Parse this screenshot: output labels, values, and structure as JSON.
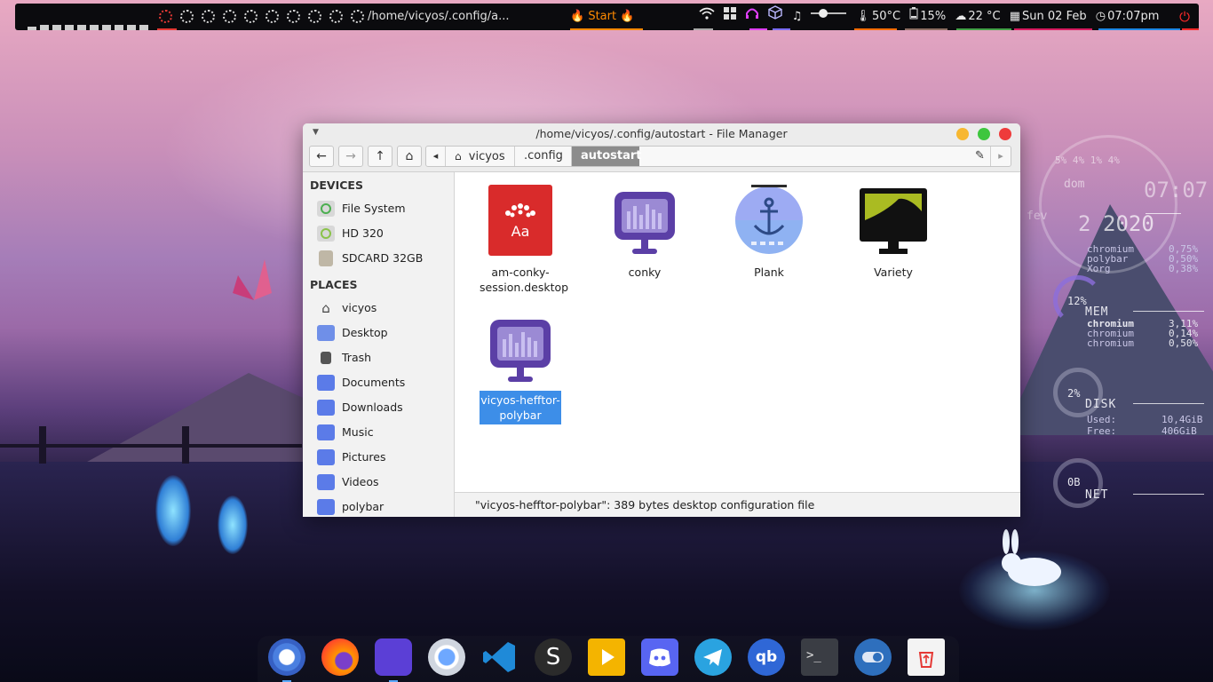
{
  "topbar": {
    "workspace_bars": [
      4,
      6,
      6,
      6,
      6,
      6,
      6,
      6,
      6,
      6
    ],
    "window_title": "/home/vicyos/.config/a...",
    "start_label": "Start",
    "temperature": "50°C",
    "battery": "15%",
    "weather": "22 °C",
    "date": "Sun 02 Feb",
    "time": "07:07pm",
    "icons": [
      "wifi-icon",
      "windows-icon",
      "headphones-icon",
      "cube-icon",
      "music-icon",
      "volume-slider",
      "thermometer-icon",
      "battery-icon",
      "cloud-icon",
      "calendar-icon",
      "clock-icon",
      "power-icon"
    ],
    "accent_colors": {
      "start": "#ff8a00",
      "power": "#ff2a2a",
      "cpu_spinner": "#e53935"
    }
  },
  "conky": {
    "cpu_cores": "5% 4% 1% 4%",
    "day_name": "dom",
    "month": "fev",
    "time": "07:07",
    "day": "2",
    "year": "2020",
    "cpu_procs": [
      {
        "name": "chromium",
        "value": "0,75%"
      },
      {
        "name": "polybar",
        "value": "0,50%"
      },
      {
        "name": "Xorg",
        "value": "0,38%"
      }
    ],
    "mem_percent": "12%",
    "mem_label": "MEM",
    "mem_procs": [
      {
        "name": "chromium",
        "value": "3,11%"
      },
      {
        "name": "chromium",
        "value": "0,14%"
      },
      {
        "name": "chromium",
        "value": "0,50%"
      }
    ],
    "disk_percent": "2%",
    "disk_label": "DISK",
    "disk_used_label": "Used:",
    "disk_used": "10,4GiB",
    "disk_free_label": "Free:",
    "disk_free": "406GiB",
    "net_value": "0B",
    "net_label": "NET"
  },
  "window": {
    "title": "/home/vicyos/.config/autostart - File Manager",
    "nav": {
      "back": "←",
      "forward": "→",
      "up": "↑",
      "home": "⌂",
      "scroll_left": "◂",
      "scroll_right": "▸",
      "edit": "✎"
    },
    "breadcrumbs": [
      "vicyos",
      ".config",
      "autostart"
    ],
    "sidebar": {
      "devices_heading": "DEVICES",
      "devices": [
        "File System",
        "HD 320",
        "SDCARD 32GB"
      ],
      "places_heading": "PLACES",
      "places": [
        "vicyos",
        "Desktop",
        "Trash",
        "Documents",
        "Downloads",
        "Music",
        "Pictures",
        "Videos",
        "polybar"
      ]
    },
    "files": [
      {
        "name": "am-conky-session.desktop",
        "line1": "am-conky-",
        "line2": "session.desktop",
        "icon": "font-app-icon",
        "icon_text": "Aa"
      },
      {
        "name": "conky",
        "line1": "conky",
        "line2": "",
        "icon": "monitor-conky-icon"
      },
      {
        "name": "Plank",
        "line1": "Plank",
        "line2": "",
        "icon": "anchor-icon"
      },
      {
        "name": "Variety",
        "line1": "Variety",
        "line2": "",
        "icon": "variety-monitor-icon"
      },
      {
        "name": "vicyos-hefftor-polybar",
        "line1": "vicyos-hefftor-",
        "line2": "polybar",
        "icon": "monitor-conky-icon",
        "selected": true
      }
    ],
    "status": "\"vicyos-hefftor-polybar\": 389 bytes desktop configuration file"
  },
  "dock": {
    "apps": [
      "chromium-icon",
      "firefox-icon",
      "file-manager-icon",
      "gnome-disks-icon",
      "vscode-icon",
      "simplenote-icon",
      "video-player-icon",
      "discord-icon",
      "telegram-icon",
      "qbittorrent-icon",
      "terminal-icon",
      "toggle-settings-icon",
      "trash-icon"
    ]
  }
}
